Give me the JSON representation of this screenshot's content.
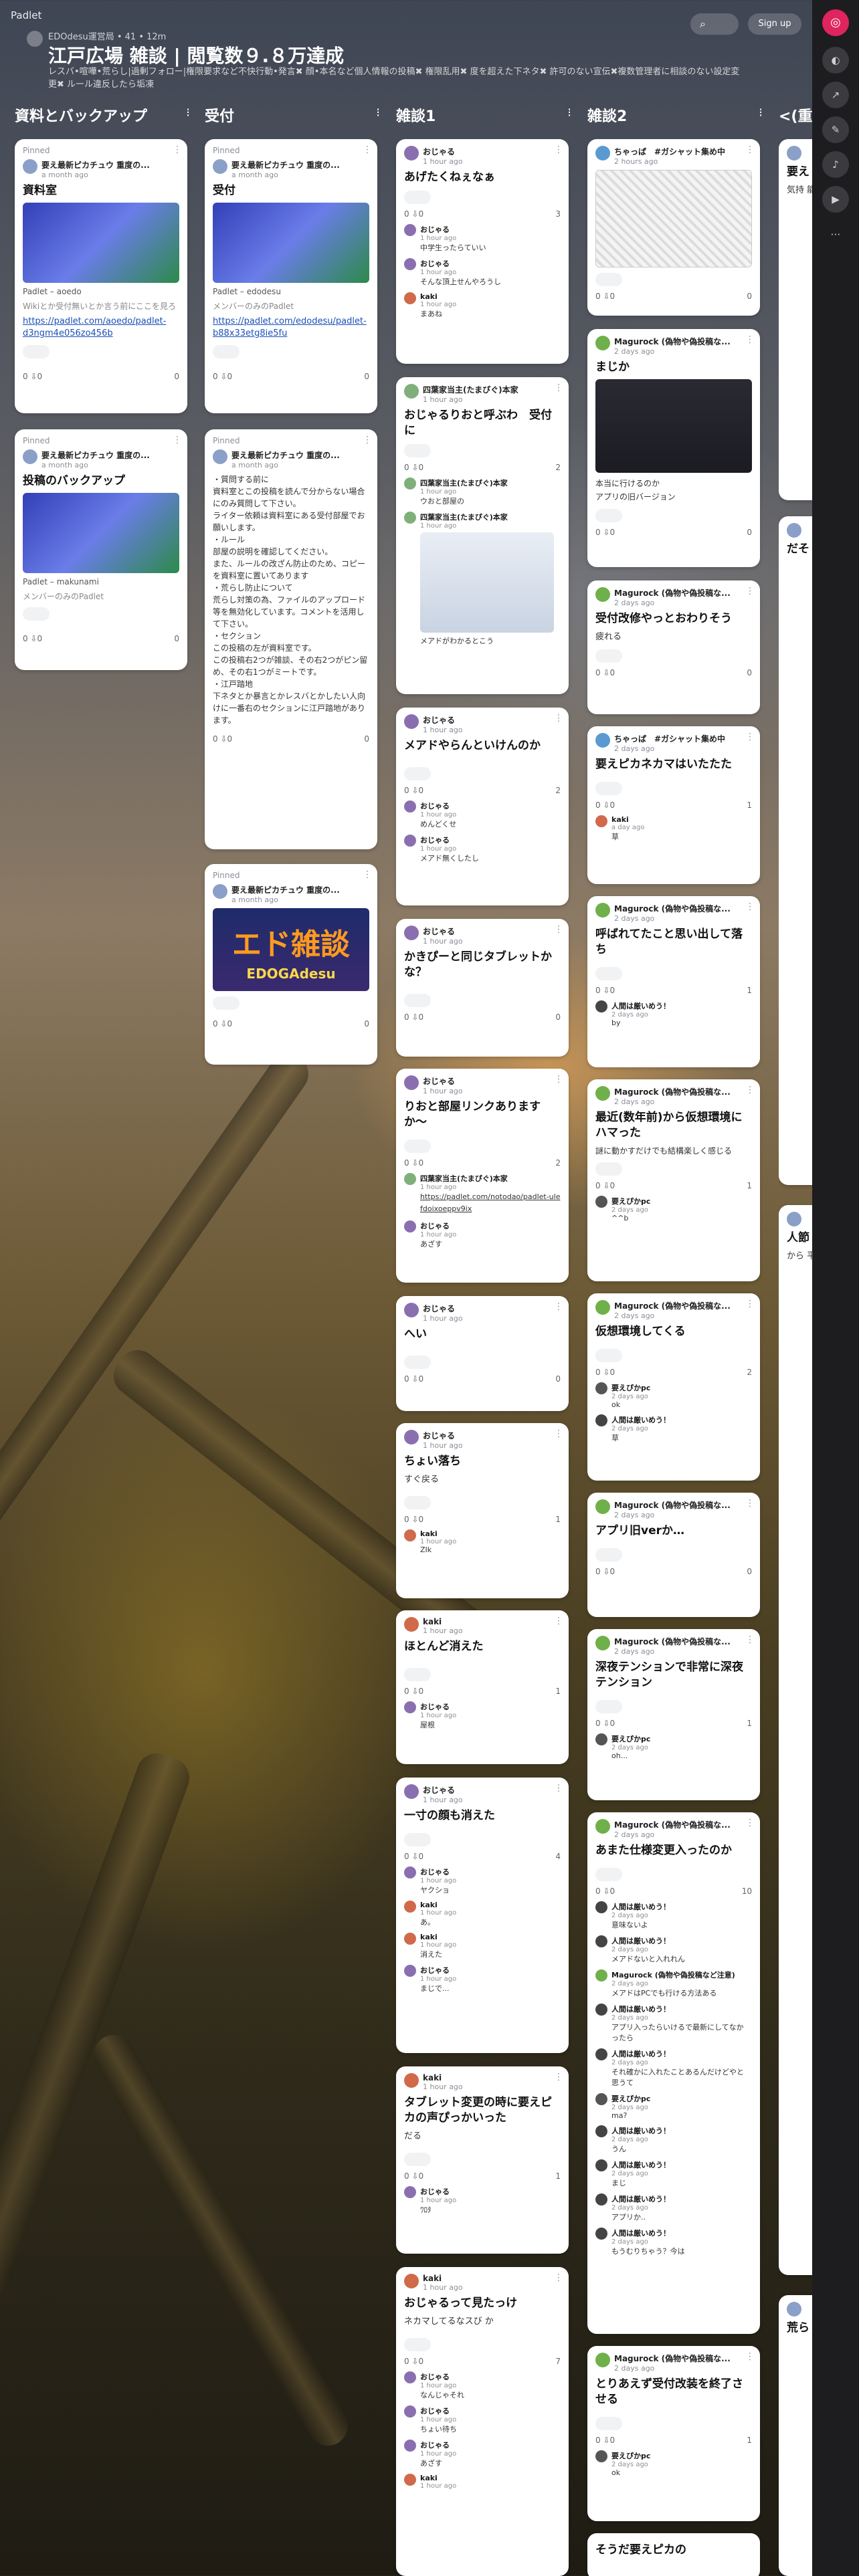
{
  "brand": "Padlet",
  "board": {
    "meta": "EDOdesu運営局 • 41 • 12m",
    "title": "江戸広場 雑談 | 閲覧数９.８万達成",
    "description": "レスバ•喧嘩•荒らし|過剰フォロー|権限要求など不快行動•発言✖︎ 顔•本名など個人情報の投稿✖︎ 権限乱用✖︎ 度を超えた下ネタ✖︎ 許可のない宣伝✖︎複数管理者に相談のない設定変更✖︎ ルール違反したら垢凍"
  },
  "header": {
    "search_icon": "⌕",
    "signup": "Sign up"
  },
  "rail": {
    "logo": "◎",
    "icons": [
      "◐",
      "↗",
      "✎",
      "♪",
      "▶",
      "⋯"
    ]
  },
  "columns": [
    {
      "title": "資料とバックアップ"
    },
    {
      "title": "受付"
    },
    {
      "title": "雑談1"
    },
    {
      "title": "雑談2"
    },
    {
      "title": "<(重"
    }
  ],
  "cards": {
    "c1": {
      "pinned": "Pinned",
      "author": "要え最新ピカチュウ 重度の...",
      "time": "a month ago",
      "title": "資料室",
      "caption": "Padlet – aoedo",
      "sub": "Wikiとか受付無いとか言う前にここを見ろ",
      "link": "https://padlet.com/aoedo/padlet-d3ngm4e056zo456b",
      "reacts": "0 ⇩0",
      "comments": "0"
    },
    "c2": {
      "pinned": "Pinned",
      "author": "要え最新ピカチュウ 重度の...",
      "time": "a month ago",
      "title": "投稿のバックアップ",
      "caption": "Padlet – makunami",
      "sub": "メンバーのみのPadlet",
      "reacts": "0 ⇩0",
      "comments": "0"
    },
    "c3": {
      "pinned": "Pinned",
      "author": "要え最新ピカチュウ 重度の...",
      "time": "a month ago",
      "title": "受付",
      "caption": "Padlet – edodesu",
      "sub": "メンバーのみのPadlet",
      "link": "https://padlet.com/edodesu/padlet-b88x33etg8ie5fu",
      "reacts": "0 ⇩0",
      "comments": "0"
    },
    "c4": {
      "pinned": "Pinned",
      "author": "要え最新ピカチュウ 重度の...",
      "time": "a month ago",
      "body": "・質問する前に\n資料室とこの投稿を読んで分からない場合にのみ質問して下さい。\nライター依頼は資料室にある受付部屋でお願いします。\n・ルール\n部屋の説明を確認してください。\nまた、ルールの改ざん防止のため、コピーを資料室に置いてあります\n・荒らし防止について\n荒らし対策の為、ファイルのアップロード等を無効化しています。コメントを活用して下さい。\n・セクション\nこの投稿の左が資料室です。\nこの投稿右2つが雑談、その右2つがピン留め、その右1つがミートです。\n・江戸踏地\n下ネタとか暴言とかレスバとかしたい人向けに一番右のセクションに江戸踏地があります。",
      "reacts": "0 ⇩0",
      "comments": "0"
    },
    "c5": {
      "pinned": "Pinned",
      "author": "要え最新ピカチュウ 重度の...",
      "time": "a month ago",
      "banner": "エド雑談",
      "banner_sub": "EDOGAdesu",
      "reacts": "0 ⇩0",
      "comments": "0"
    },
    "z1": {
      "author": "おじゃる",
      "time": "1 hour ago",
      "title": "あげたくねぇなぁ",
      "reacts": "0 ⇩0",
      "comments": "3",
      "comments_list": [
        {
          "name": "おじゃる",
          "time": "1 hour ago",
          "text": "中学生ったらていい"
        },
        {
          "name": "おじゃる",
          "time": "1 hour ago",
          "text": "そんな頂上せんやろうし"
        },
        {
          "name": "kaki",
          "time": "1 hour ago",
          "text": "まあね"
        }
      ]
    },
    "z2": {
      "author": "四葉家当主(たまぴぐ)本家",
      "time": "1 hour ago",
      "title": "おじゃるりおと呼ぶわ　受付に",
      "reacts": "0 ⇩0",
      "comments": "2",
      "comments_list": [
        {
          "name": "四葉家当主(たまぴぐ)本家",
          "time": "1 hour ago",
          "text": "ウおと部屋の"
        },
        {
          "name": "四葉家当主(たまぴぐ)本家",
          "time": "1 hour ago",
          "text": "メアドがわかるとこう"
        }
      ]
    },
    "z3": {
      "author": "おじゃる",
      "time": "1 hour ago",
      "title": "メアドやらんといけんのか",
      "reacts": "0 ⇩0",
      "comments": "2",
      "comments_list": [
        {
          "name": "おじゃる",
          "time": "1 hour ago",
          "text": "めんどくせ"
        },
        {
          "name": "おじゃる",
          "time": "1 hour ago",
          "text": "メアド無くしたし"
        }
      ]
    },
    "z4": {
      "author": "おじゃる",
      "time": "1 hour ago",
      "title": "かきぴーと同じタブレットかな？",
      "reacts": "0 ⇩0",
      "comments": "0"
    },
    "z5": {
      "author": "おじゃる",
      "time": "1 hour ago",
      "title": "りおと部屋リンクありますか〜",
      "reacts": "0 ⇩0",
      "comments": "2",
      "comments_list": [
        {
          "name": "四葉家当主(たまぴぐ)本家",
          "time": "1 hour ago",
          "text": "https://padlet.com/notodao/padlet-ulefdoixoeppv9ix"
        },
        {
          "name": "おじゃる",
          "time": "1 hour ago",
          "text": "あざす"
        }
      ]
    },
    "z6": {
      "author": "おじゃる",
      "time": "1 hour ago",
      "title": "へい",
      "reacts": "0 ⇩0",
      "comments": "0"
    },
    "z7": {
      "author": "おじゃる",
      "time": "1 hour ago",
      "title": "ちょい落ち",
      "body": "すぐ戻る",
      "reacts": "0 ⇩0",
      "comments": "1",
      "comments_list": [
        {
          "name": "kaki",
          "time": "1 hour ago",
          "text": "ZIk"
        }
      ]
    },
    "z8": {
      "author": "kaki",
      "time": "1 hour ago",
      "title": "ほとんど消えた",
      "reacts": "0 ⇩0",
      "comments": "1",
      "comments_list": [
        {
          "name": "おじゃる",
          "time": "1 hour ago",
          "text": "屋根"
        }
      ]
    },
    "z9": {
      "author": "おじゃる",
      "time": "1 hour ago",
      "title": "一寸の顔も消えた",
      "reacts": "0 ⇩0",
      "comments": "4",
      "comments_list": [
        {
          "name": "おじゃる",
          "time": "1 hour ago",
          "text": "ヤクショ"
        },
        {
          "name": "kaki",
          "time": "1 hour ago",
          "text": "あ。"
        },
        {
          "name": "kaki",
          "time": "1 hour ago",
          "text": "消えた"
        },
        {
          "name": "おじゃる",
          "time": "1 hour ago",
          "text": "まじで..."
        }
      ]
    },
    "z10": {
      "author": "kaki",
      "time": "1 hour ago",
      "title": "タブレット変更の時に要えピカの声ぴっかいった",
      "body": "だる",
      "reacts": "0 ⇩0",
      "comments": "1",
      "comments_list": [
        {
          "name": "おじゃる",
          "time": "1 hour ago",
          "text": "ﾜﾛﾀ"
        }
      ]
    },
    "z11": {
      "author": "kaki",
      "time": "1 hour ago",
      "title": "おじゃるって見たっけ",
      "body": "ネカマしてるなスび か",
      "reacts": "0 ⇩0",
      "comments": "7",
      "comments_list": [
        {
          "name": "おじゃる",
          "time": "1 hour ago",
          "text": "なんじゃそれ"
        },
        {
          "name": "おじゃる",
          "time": "1 hour ago",
          "text": "ちょい待ち"
        },
        {
          "name": "おじゃる",
          "time": "1 hour ago",
          "text": "あざす"
        },
        {
          "name": "kaki",
          "time": "1 hour ago",
          "text": ""
        }
      ]
    },
    "y1": {
      "author": "ちゃっぱ　#ガシャット集め中",
      "time": "2 hours ago",
      "reacts": "0 ⇩0",
      "comments": "0"
    },
    "y2": {
      "author": "Magurock (偽物や偽投稿な...",
      "time": "2 days ago",
      "title": "まじか",
      "body": "本当に行けるのか\nアプリの旧バージョン",
      "reacts": "0 ⇩0",
      "comments": "0"
    },
    "y3": {
      "author": "Magurock (偽物や偽投稿な...",
      "time": "2 days ago",
      "title": "受付改修やっとおわりそう",
      "body": "疲れる",
      "reacts": "0 ⇩0",
      "comments": "0"
    },
    "y4": {
      "author": "ちゃっぱ　#ガシャット集め中",
      "time": "2 days ago",
      "title": "要えピカネカマはいたたた",
      "reacts": "0 ⇩0",
      "comments": "1",
      "comments_list": [
        {
          "name": "kaki",
          "time": "a day ago",
          "text": "草"
        }
      ]
    },
    "y5": {
      "author": "Magurock (偽物や偽投稿な...",
      "time": "2 days ago",
      "title": "呼ばれてたこと思い出して落ち",
      "reacts": "0 ⇩0",
      "comments": "1",
      "comments_list": [
        {
          "name": "人間は厳いめう！",
          "time": "2 days ago",
          "text": "by"
        }
      ]
    },
    "y6": {
      "author": "Magurock (偽物や偽投稿な...",
      "time": "2 days ago",
      "title": "最近(数年前)から仮想環境にハマった",
      "body": "謎に動かすだけでも結構楽しく感じる",
      "reacts": "0 ⇩0",
      "comments": "1",
      "comments_list": [
        {
          "name": "要えぴかpc",
          "time": "2 days ago",
          "text": "^^b"
        }
      ]
    },
    "y7": {
      "author": "Magurock (偽物や偽投稿な...",
      "time": "2 days ago",
      "title": "仮想環境してくる",
      "reacts": "0 ⇩0",
      "comments": "2",
      "comments_list": [
        {
          "name": "要えぴかpc",
          "time": "2 days ago",
          "text": "ok"
        },
        {
          "name": "人間は厳いめう！",
          "time": "2 days ago",
          "text": "草"
        }
      ]
    },
    "y8": {
      "author": "Magurock (偽物や偽投稿な...",
      "time": "2 days ago",
      "title": "アプリ旧verか…",
      "reacts": "0 ⇩0",
      "comments": "0"
    },
    "y9": {
      "author": "Magurock (偽物や偽投稿な...",
      "time": "2 days ago",
      "title": "深夜テンションで非常に深夜テンション",
      "reacts": "0 ⇩0",
      "comments": "1",
      "comments_list": [
        {
          "name": "要えぴかpc",
          "time": "2 days ago",
          "text": "oh..."
        }
      ]
    },
    "y10": {
      "author": "Magurock (偽物や偽投稿な...",
      "time": "2 days ago",
      "title": "あまた仕様変更入ったのか",
      "reacts": "0 ⇩0",
      "comments": "10",
      "comments_list": [
        {
          "name": "人間は厳いめう！",
          "time": "2 days ago",
          "text": "意味ないよ"
        },
        {
          "name": "人間は厳いめう！",
          "time": "2 days ago",
          "text": "メアドないと入れれん"
        },
        {
          "name": "Magurock (偽物や偽投稿など注意)",
          "time": "2 days ago",
          "text": "メアドはPCでも行ける方法ある"
        },
        {
          "name": "人間は厳いめう！",
          "time": "2 days ago",
          "text": "アプリ入ったらいけるで最新にしてなかったら"
        },
        {
          "name": "人間は厳いめう！",
          "time": "2 days ago",
          "text": "それ確かに入れたことあるんだけどやと思うて"
        },
        {
          "name": "要えぴかpc",
          "time": "2 days ago",
          "text": "ma?"
        },
        {
          "name": "人間は厳いめう！",
          "time": "2 days ago",
          "text": "うん"
        },
        {
          "name": "人間は厳いめう！",
          "time": "2 days ago",
          "text": "まじ"
        },
        {
          "name": "人間は厳いめう！",
          "time": "2 days ago",
          "text": "アプリか.."
        },
        {
          "name": "人間は厳いめう！",
          "time": "2 days ago",
          "text": "もうむりちゃう？今は"
        }
      ]
    },
    "y11": {
      "author": "Magurock (偽物や偽投稿な...",
      "time": "2 days ago",
      "title": "とりあえず受付改装を終了させる",
      "reacts": "0 ⇩0",
      "comments": "1",
      "comments_list": [
        {
          "name": "要えぴかpc",
          "time": "2 days ago",
          "text": "ok"
        }
      ]
    },
    "y12": {
      "title": "そうだ要えピカの"
    },
    "w1": {
      "title": "要え",
      "body": "気持 能っ"
    },
    "w2": {
      "title": "だそ"
    },
    "w3": {
      "title": "人節",
      "body": "から 平和 的な (+の"
    },
    "w4": {
      "title": "荒ら"
    }
  }
}
